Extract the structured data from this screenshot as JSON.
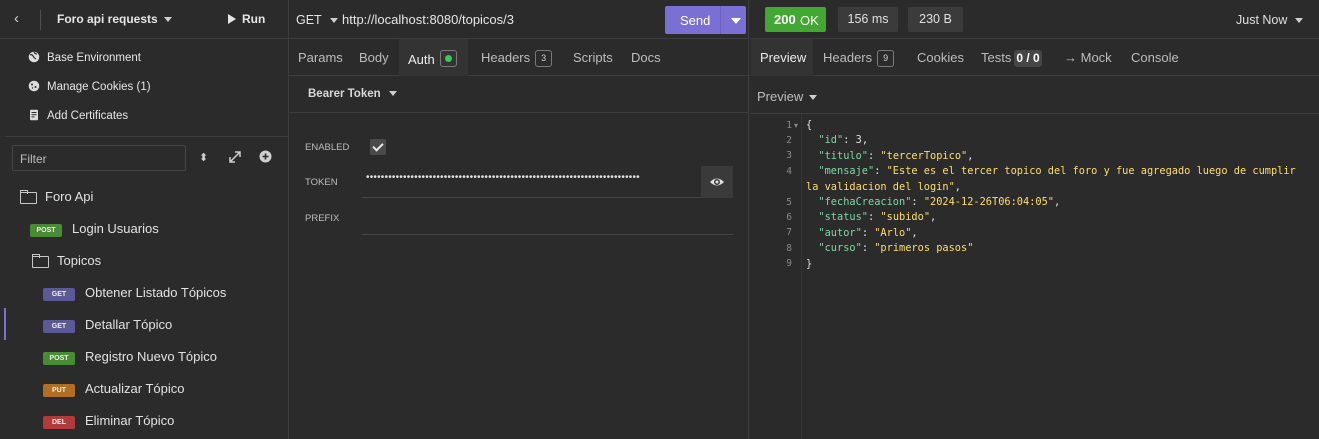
{
  "sidebar": {
    "project_title": "Foro api requests",
    "run_label": "Run",
    "menu": [
      {
        "icon": "globe-icon",
        "label": "Base Environment"
      },
      {
        "icon": "cookie-icon",
        "label": "Manage Cookies (1)"
      },
      {
        "icon": "certificate-icon",
        "label": "Add Certificates"
      }
    ],
    "filter_placeholder": "Filter",
    "tree": {
      "root_folder": "Foro Api",
      "login": {
        "method": "POST",
        "name": "Login Usuarios"
      },
      "sub_folder": "Topicos",
      "requests": [
        {
          "method": "GET",
          "name": "Obtener Listado Tópicos"
        },
        {
          "method": "GET",
          "name": "Detallar Tópico",
          "active": true
        },
        {
          "method": "POST",
          "name": "Registro Nuevo Tópico"
        },
        {
          "method": "PUT",
          "name": "Actualizar Tópico"
        },
        {
          "method": "DEL",
          "name": "Eliminar Tópico"
        }
      ]
    }
  },
  "request": {
    "method": "GET",
    "url": "http://localhost:8080/topicos/3",
    "send_label": "Send",
    "tabs": [
      {
        "label": "Params"
      },
      {
        "label": "Body"
      },
      {
        "label": "Auth",
        "active": true
      },
      {
        "label": "Headers",
        "count": "3"
      },
      {
        "label": "Scripts"
      },
      {
        "label": "Docs"
      }
    ],
    "auth_type": "Bearer Token",
    "fields": {
      "enabled_label": "ENABLED",
      "enabled_checked": true,
      "token_label": "TOKEN",
      "token_value": "••••••••••••••••••••••••••••••••••••••••••••••••••••••••••••••••••••••••••",
      "prefix_label": "PREFIX",
      "prefix_value": ""
    }
  },
  "response": {
    "status_code": "200",
    "status_text": "OK",
    "time": "156 ms",
    "size": "230 B",
    "timestamp": "Just Now",
    "tabs": [
      {
        "label": "Preview",
        "active": true
      },
      {
        "label": "Headers",
        "count": "9"
      },
      {
        "label": "Cookies"
      },
      {
        "label": "Tests",
        "count": "0 / 0"
      },
      {
        "label": "→ Mock"
      },
      {
        "label": "Console"
      }
    ],
    "preview_mode": "Preview",
    "line_numbers": [
      "1",
      "2",
      "3",
      "4",
      "",
      "5",
      "6",
      "7",
      "8",
      "9"
    ],
    "body": {
      "id": "3",
      "titulo": "\"tercerTopico\"",
      "mensaje_1": "\"Este es el tercer topico del foro y fue agregado luego de cumplir",
      "mensaje_2": "la validacion del login\"",
      "fechaCreacion": "\"2024-12-26T06:04:05\"",
      "status": "\"subido\"",
      "autor": "\"Arlo\"",
      "curso": "\"primeros pasos\""
    }
  },
  "colors": {
    "accent": "#7a6fd2",
    "success": "#42a733",
    "post": "#4a8b35",
    "get": "#5a5a97",
    "put": "#b06f22",
    "del": "#b13b3b"
  }
}
